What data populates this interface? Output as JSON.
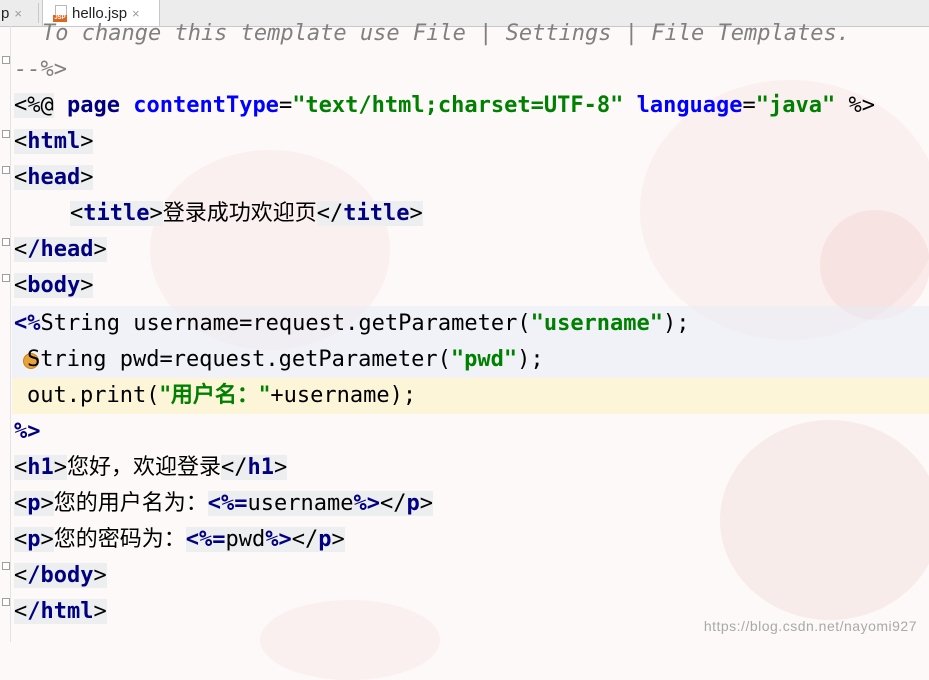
{
  "tabs": {
    "previous": {
      "label": "p",
      "close": "×"
    },
    "active": {
      "icon": "jsp-file-icon",
      "icon_label": "JSP",
      "label": "hello.jsp",
      "close": "×"
    }
  },
  "code": {
    "comment_line": "To change this template use File | Settings | File Templates.",
    "comment_end": "--%>",
    "directive": {
      "open": "<%@",
      "page": "page",
      "content_type_attr": "contentType",
      "content_type_value": "\"text/html;charset=UTF-8\"",
      "language_attr": "language",
      "language_value": "\"java\"",
      "close": "%>"
    },
    "html_open": "html",
    "head_open": "head",
    "title_tag": "title",
    "title_text": "登录成功欢迎页",
    "head_close": "/head",
    "body_open": "body",
    "scriptlet_open": "<%",
    "line_username_prefix": "String username=request.getParameter(",
    "username_string": "\"username\"",
    "line_suffix": ");",
    "line_pwd_prefix": "String pwd=request.getParameter(",
    "pwd_string": "\"pwd\"",
    "line_print_prefix": "out.print(",
    "print_string": "\"用户名：\"",
    "line_print_suffix": "+username);",
    "scriptlet_close": "%>",
    "h1_tag": "h1",
    "h1_text": "您好，欢迎登录",
    "p_tag": "p",
    "p1_text": "您的用户名为：",
    "expr_open": "<%=",
    "p1_expr": "username",
    "expr_close": "%>",
    "p2_text": "您的密码为：",
    "p2_expr": "pwd",
    "body_close": "/body",
    "html_close": "/html"
  },
  "watermark": "https://blog.csdn.net/nayomi927",
  "colors": {
    "tag": "#000080",
    "attribute": "#0000ff",
    "string": "#008000",
    "comment": "#808080",
    "caret_line": "#fdf5d2"
  }
}
